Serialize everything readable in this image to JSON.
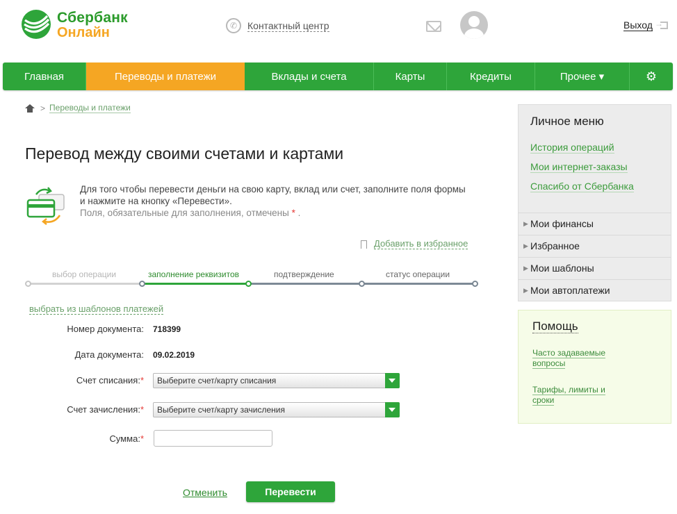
{
  "header": {
    "logo_line1": "Сбербанк",
    "logo_line2": "Онлайн",
    "contact_label": "Контактный центр",
    "logout_label": "Выход"
  },
  "nav": {
    "items": [
      {
        "label": "Главная",
        "active": false
      },
      {
        "label": "Переводы и платежи",
        "active": true
      },
      {
        "label": "Вклады и счета",
        "active": false
      },
      {
        "label": "Карты",
        "active": false
      },
      {
        "label": "Кредиты",
        "active": false
      },
      {
        "label": "Прочее ▾",
        "active": false
      }
    ],
    "settings_icon": "gear-icon"
  },
  "breadcrumb": {
    "current": "Переводы и платежи"
  },
  "page": {
    "title": "Перевод между своими счетами и картами",
    "info_line1": "Для того чтобы перевести деньги на свою карту, вклад или счет, заполните поля формы и нажмите на кнопку «Перевести».",
    "required_note": "Поля, обязательные для заполнения, отмечены",
    "required_star": "*",
    "required_dot": ".",
    "add_favorite": "Добавить в избранное"
  },
  "steps": [
    {
      "label": "выбор операции",
      "state": "done"
    },
    {
      "label": "заполнение реквизитов",
      "state": "active"
    },
    {
      "label": "подтверждение",
      "state": "pending"
    },
    {
      "label": "статус операции",
      "state": "pending"
    }
  ],
  "form": {
    "templates_link": "выбрать из шаблонов платежей",
    "doc_number_label": "Номер документа:",
    "doc_number_value": "718399",
    "doc_date_label": "Дата документа:",
    "doc_date_value": "09.02.2019",
    "from_label": "Счет списания:",
    "from_placeholder": "Выберите счет/карту списания",
    "to_label": "Счет зачисления:",
    "to_placeholder": "Выберите счет/карту зачисления",
    "amount_label": "Сумма:",
    "amount_value": "",
    "required_star": "*",
    "cancel_label": "Отменить",
    "submit_label": "Перевести"
  },
  "personal_menu": {
    "title": "Личное меню",
    "links": [
      "История операций",
      "Мои интернет-заказы",
      "Спасибо от Сбербанка"
    ],
    "sections": [
      "Мои финансы",
      "Избранное",
      "Мои шаблоны",
      "Мои автоплатежи"
    ]
  },
  "help": {
    "title": "Помощь",
    "links": [
      "Часто задаваемые вопросы",
      "Тарифы, лимиты и сроки"
    ]
  },
  "colors": {
    "brand_green": "#2ea53a",
    "active_orange": "#f5a623",
    "link_green": "#6aa06a"
  }
}
